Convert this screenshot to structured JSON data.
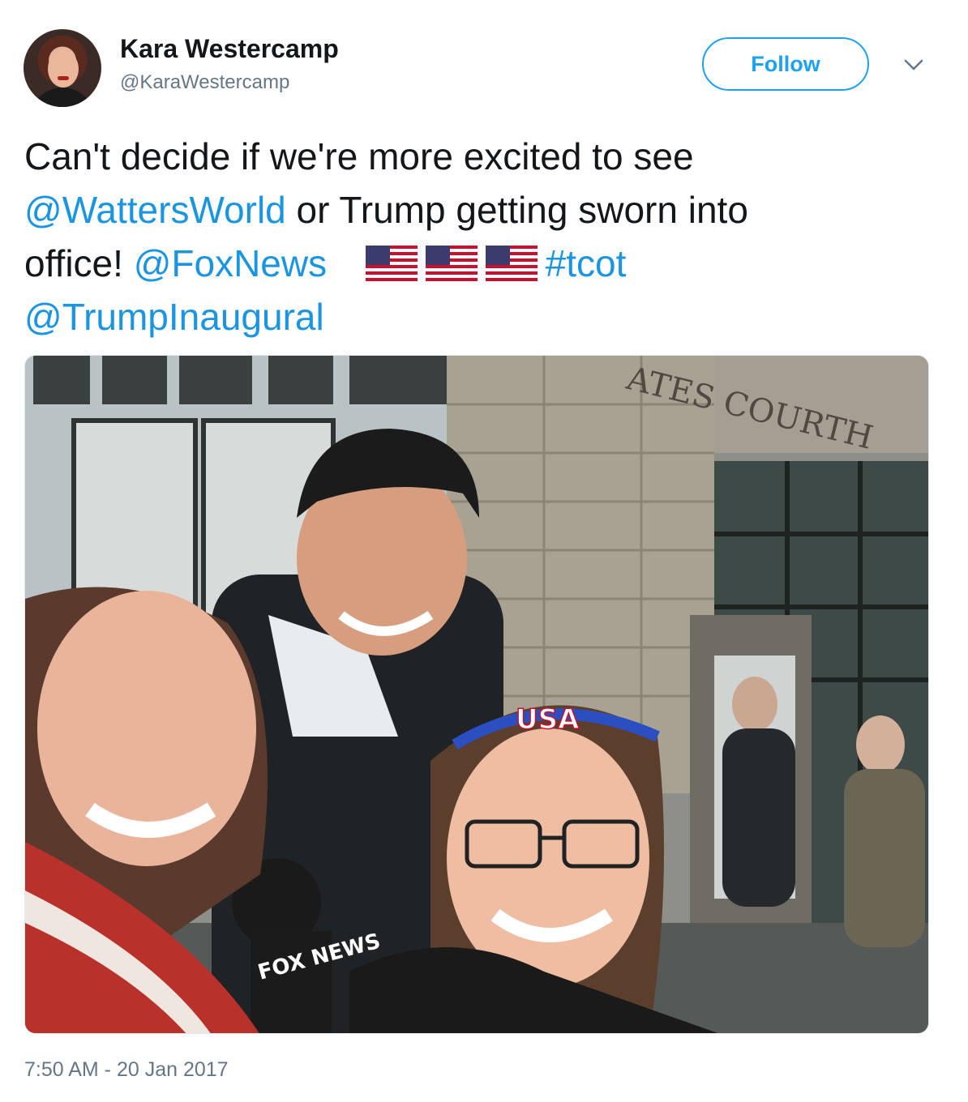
{
  "author": {
    "name": "Kara Westercamp",
    "handle": "@KaraWestercamp"
  },
  "actions": {
    "follow_label": "Follow"
  },
  "tweet": {
    "line1": "Can't decide if we're more excited to see",
    "mention1": "@WattersWorld",
    "line2_rest": " or Trump getting sworn into",
    "line3_start": "office! ",
    "mention2": "@FoxNews",
    "hashtag": "#tcot",
    "mention3": "@TrumpInaugural",
    "emoji_count": 3
  },
  "photo": {
    "building_text": "ATES  COURTH",
    "mic_flag_text": "FOX NEWS",
    "headband_text": "USA"
  },
  "timestamp": "7:50 AM - 20 Jan 2017",
  "colors": {
    "link": "#1b95e0",
    "follow_border": "#1da1f2",
    "secondary_text": "#657786"
  }
}
